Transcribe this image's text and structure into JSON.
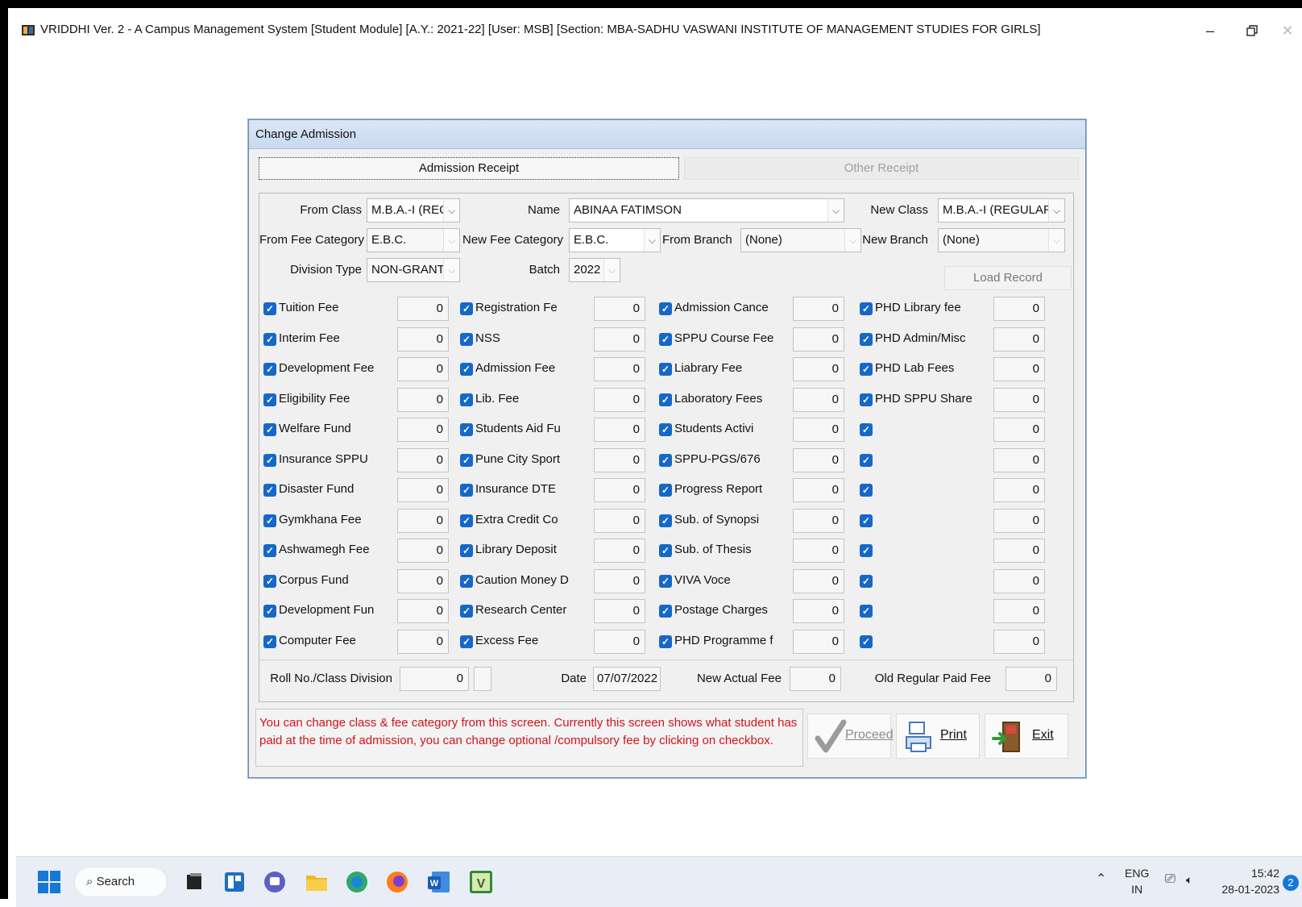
{
  "window": {
    "title": "VRIDDHI Ver. 2 - A Campus Management System [Student Module] [A.Y.: 2021-22] [User: MSB] [Section: MBA-SADHU VASWANI INSTITUTE OF MANAGEMENT STUDIES FOR GIRLS]",
    "minimize_icon": "minimize-icon",
    "restore_icon": "restore-icon",
    "close_icon": "close-icon"
  },
  "dialog": {
    "caption": "Change Admission",
    "tabs": [
      {
        "label": "Admission Receipt",
        "active": true
      },
      {
        "label": "Other Receipt",
        "active": false
      }
    ]
  },
  "form": {
    "from_class_label": "From Class",
    "from_class_value": "M.B.A.-I (REGU",
    "name_label": "Name",
    "name_value": "ABINAA FATIMSON",
    "new_class_label": "New Class",
    "new_class_value": "M.B.A.-I (REGULAR)",
    "from_fee_category_label": "From Fee Category",
    "from_fee_category_value": "E.B.C.",
    "new_fee_category_label": "New Fee Category",
    "new_fee_category_value": "E.B.C.",
    "from_branch_label": "From Branch",
    "from_branch_value": "(None)",
    "new_branch_label": "New Branch",
    "new_branch_value": "(None)",
    "division_type_label": "Division Type",
    "division_type_value": "NON-GRANT",
    "batch_label": "Batch",
    "batch_value": "2022",
    "load_record_label": "Load Record"
  },
  "fees": {
    "col1": [
      {
        "name": "Tuition Fee",
        "value": "0",
        "checked": true
      },
      {
        "name": "Interim Fee",
        "value": "0",
        "checked": true
      },
      {
        "name": "Development Fee",
        "value": "0",
        "checked": true
      },
      {
        "name": "Eligibility Fee",
        "value": "0",
        "checked": true
      },
      {
        "name": "Welfare Fund",
        "value": "0",
        "checked": true
      },
      {
        "name": "Insurance SPPU",
        "value": "0",
        "checked": true
      },
      {
        "name": "Disaster Fund",
        "value": "0",
        "checked": true
      },
      {
        "name": "Gymkhana Fee",
        "value": "0",
        "checked": true
      },
      {
        "name": "Ashwamegh Fee",
        "value": "0",
        "checked": true
      },
      {
        "name": "Corpus Fund",
        "value": "0",
        "checked": true
      },
      {
        "name": "Development Fun",
        "value": "0",
        "checked": true
      },
      {
        "name": "Computer Fee",
        "value": "0",
        "checked": true
      }
    ],
    "col2": [
      {
        "name": "Registration Fe",
        "value": "0",
        "checked": true
      },
      {
        "name": "NSS",
        "value": "0",
        "checked": true
      },
      {
        "name": "Admission Fee",
        "value": "0",
        "checked": true
      },
      {
        "name": "Lib. Fee",
        "value": "0",
        "checked": true
      },
      {
        "name": "Students Aid Fu",
        "value": "0",
        "checked": true
      },
      {
        "name": "Pune City Sport",
        "value": "0",
        "checked": true
      },
      {
        "name": "Insurance DTE",
        "value": "0",
        "checked": true
      },
      {
        "name": "Extra Credit Co",
        "value": "0",
        "checked": true
      },
      {
        "name": "Library Deposit",
        "value": "0",
        "checked": true
      },
      {
        "name": "Caution Money D",
        "value": "0",
        "checked": true
      },
      {
        "name": "Research Center",
        "value": "0",
        "checked": true
      },
      {
        "name": "Excess Fee",
        "value": "0",
        "checked": true
      }
    ],
    "col3": [
      {
        "name": "Admission Cance",
        "value": "0",
        "checked": true
      },
      {
        "name": "SPPU Course Fee",
        "value": "0",
        "checked": true
      },
      {
        "name": "Liabrary Fee",
        "value": "0",
        "checked": true
      },
      {
        "name": "Laboratory Fees",
        "value": "0",
        "checked": true
      },
      {
        "name": "Students Activi",
        "value": "0",
        "checked": true
      },
      {
        "name": "SPPU-PGS/676",
        "value": "0",
        "checked": true
      },
      {
        "name": "Progress Report",
        "value": "0",
        "checked": true
      },
      {
        "name": "Sub. of Synopsi",
        "value": "0",
        "checked": true
      },
      {
        "name": "Sub. of Thesis",
        "value": "0",
        "checked": true
      },
      {
        "name": "VIVA Voce",
        "value": "0",
        "checked": true
      },
      {
        "name": "Postage Charges",
        "value": "0",
        "checked": true
      },
      {
        "name": "PHD Programme f",
        "value": "0",
        "checked": true
      }
    ],
    "col4": [
      {
        "name": "PHD Library fee",
        "value": "0",
        "checked": true
      },
      {
        "name": "PHD Admin/Misc",
        "value": "0",
        "checked": true
      },
      {
        "name": "PHD Lab Fees",
        "value": "0",
        "checked": true
      },
      {
        "name": "PHD SPPU Share",
        "value": "0",
        "checked": true
      },
      {
        "name": "",
        "value": "0",
        "checked": true
      },
      {
        "name": "",
        "value": "0",
        "checked": true
      },
      {
        "name": "",
        "value": "0",
        "checked": true
      },
      {
        "name": "",
        "value": "0",
        "checked": true
      },
      {
        "name": "",
        "value": "0",
        "checked": true
      },
      {
        "name": "",
        "value": "0",
        "checked": true
      },
      {
        "name": "",
        "value": "0",
        "checked": true
      },
      {
        "name": "",
        "value": "0",
        "checked": true
      }
    ]
  },
  "footer": {
    "roll_label": "Roll No./Class Division",
    "roll_value": "0",
    "division_value": "",
    "date_label": "Date",
    "date_value": "07/07/2022",
    "new_actual_fee_label": "New Actual Fee",
    "new_actual_fee_value": "0",
    "old_regular_paid_fee_label": "Old Regular Paid Fee",
    "old_regular_paid_fee_value": "0"
  },
  "info_message": "You can change class & fee category from this screen. Currently this screen shows what student has paid at the time of admission, you can change optional /compulsory fee by clicking on checkbox.",
  "actions": {
    "proceed_label": "Proceed",
    "print_label": "Print",
    "exit_label": "Exit"
  },
  "taskbar": {
    "search_label": "Search",
    "lang_top": "ENG",
    "lang_bottom": "IN",
    "time": "15:42",
    "date": "28-01-2023",
    "notification_count": "2"
  },
  "colors": {
    "checkbox": "#1668c8",
    "info_text": "#d2141b",
    "dialog_caption": "#d9e6f5"
  }
}
